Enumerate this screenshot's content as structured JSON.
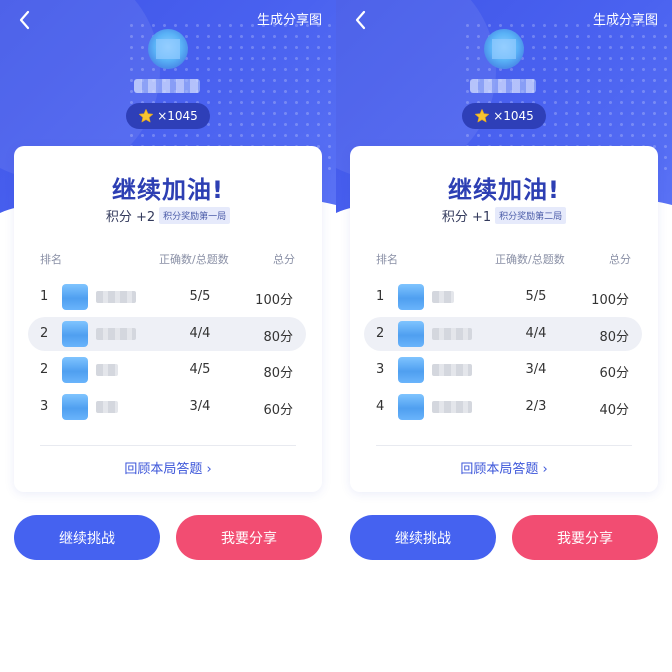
{
  "panels": [
    {
      "header": {
        "share_image_label": "生成分享图"
      },
      "score_badge": "×1045",
      "card": {
        "title": "继续加油!",
        "points": "积分 +2",
        "reward_tag": "积分奖励第一局",
        "columns": {
          "rank": "排名",
          "ratio": "正确数/总题数",
          "total": "总分"
        },
        "rows": [
          {
            "rank": "1",
            "name": "",
            "ratio": "5/5",
            "total": "100分"
          },
          {
            "rank": "2",
            "name": "..",
            "ratio": "4/4",
            "total": "80分"
          },
          {
            "rank": "2",
            "name": "",
            "ratio": "4/5",
            "total": "80分"
          },
          {
            "rank": "3",
            "name": "",
            "ratio": "3/4",
            "total": "60分"
          }
        ],
        "review_link": "回顾本局答题 ›"
      },
      "buttons": {
        "continue": "继续挑战",
        "share": "我要分享"
      }
    },
    {
      "header": {
        "share_image_label": "生成分享图"
      },
      "score_badge": "×1045",
      "card": {
        "title": "继续加油!",
        "points": "积分 +1",
        "reward_tag": "积分奖励第二局",
        "columns": {
          "rank": "排名",
          "ratio": "正确数/总题数",
          "total": "总分"
        },
        "rows": [
          {
            "rank": "1",
            "name": "",
            "ratio": "5/5",
            "total": "100分"
          },
          {
            "rank": "2",
            "name": ".",
            "ratio": "4/4",
            "total": "80分"
          },
          {
            "rank": "3",
            "name": "",
            "ratio": "3/4",
            "total": "60分"
          },
          {
            "rank": "4",
            "name": "",
            "ratio": "2/3",
            "total": "40分"
          }
        ],
        "review_link": "回顾本局答题 ›"
      },
      "buttons": {
        "continue": "继续挑战",
        "share": "我要分享"
      }
    }
  ],
  "colors": {
    "hero_blue": "#4a62f0",
    "title_blue": "#2d3fb3",
    "link_blue": "#3b55d9",
    "continue_button": "#4562f0",
    "share_button": "#f24d72",
    "star": "#f7c531"
  },
  "icons": {
    "back": "chevron-left-icon",
    "star": "star-icon",
    "review_arrow": "chevron-right-icon"
  }
}
